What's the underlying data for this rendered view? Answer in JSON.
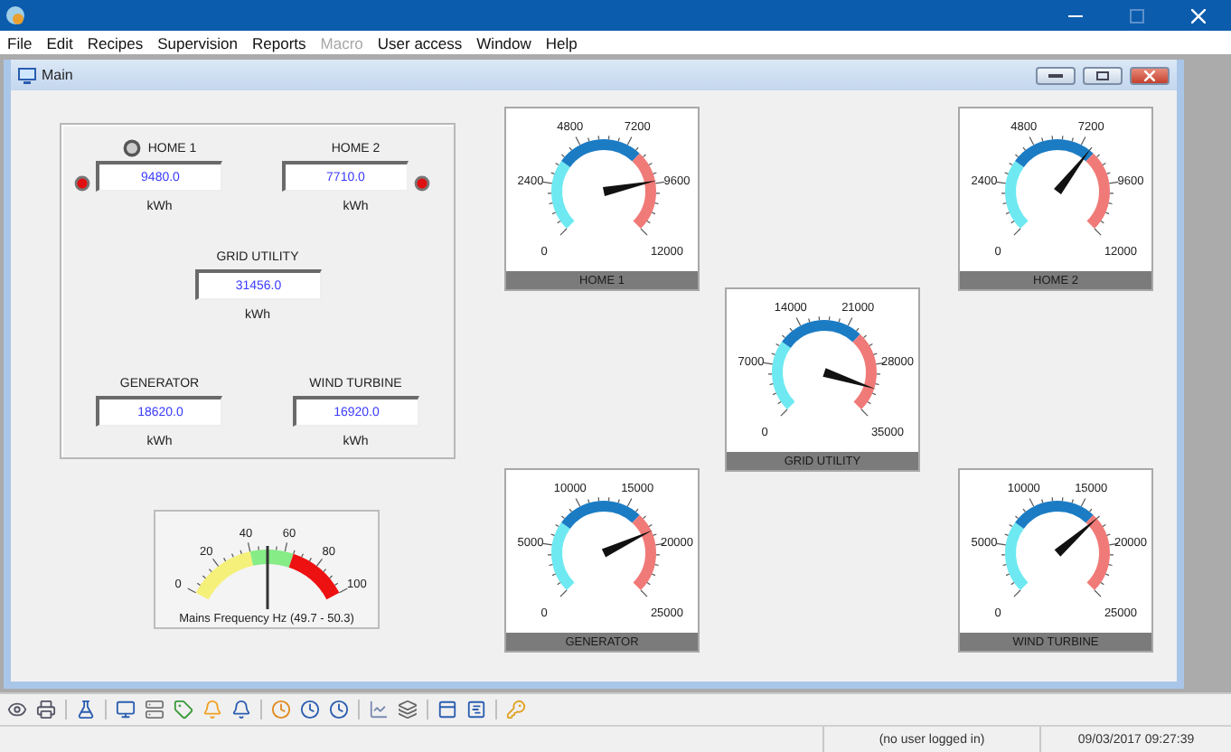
{
  "menu": [
    {
      "label": "File",
      "disabled": false
    },
    {
      "label": "Edit",
      "disabled": false
    },
    {
      "label": "Recipes",
      "disabled": false
    },
    {
      "label": "Supervision",
      "disabled": false
    },
    {
      "label": "Reports",
      "disabled": false
    },
    {
      "label": "Macro",
      "disabled": true
    },
    {
      "label": "User access",
      "disabled": false
    },
    {
      "label": "Window",
      "disabled": false
    },
    {
      "label": "Help",
      "disabled": false
    }
  ],
  "child_window": {
    "title": "Main"
  },
  "meters": [
    {
      "label": "HOME 1",
      "value": "9480.0",
      "unit": "kWh",
      "lamp": true
    },
    {
      "label": "HOME 2",
      "value": "7710.0",
      "unit": "kWh",
      "lamp": true
    },
    {
      "label": "GRID UTILITY",
      "value": "31456.0",
      "unit": "kWh",
      "lamp": false
    },
    {
      "label": "GENERATOR",
      "value": "18620.0",
      "unit": "kWh",
      "lamp": false
    },
    {
      "label": "WIND TURBINE",
      "value": "16920.0",
      "unit": "kWh",
      "lamp": false
    }
  ],
  "gauges": [
    {
      "title": "HOME 1",
      "scale": [
        "0",
        "2400",
        "4800",
        "7200",
        "9600",
        "12000"
      ]
    },
    {
      "title": "HOME 2",
      "scale": [
        "0",
        "2400",
        "4800",
        "7200",
        "9600",
        "12000"
      ]
    },
    {
      "title": "GRID UTILITY",
      "scale": [
        "0",
        "7000",
        "14000",
        "21000",
        "28000",
        "35000"
      ]
    },
    {
      "title": "GENERATOR",
      "scale": [
        "0",
        "5000",
        "10000",
        "15000",
        "20000",
        "25000"
      ]
    },
    {
      "title": "WIND TURBINE",
      "scale": [
        "0",
        "5000",
        "10000",
        "15000",
        "20000",
        "25000"
      ]
    }
  ],
  "frequency": {
    "caption": "Mains Frequency Hz (49.7 - 50.3)",
    "scale": [
      "0",
      "20",
      "40",
      "60",
      "80",
      "100"
    ]
  },
  "status_bar": [
    "(no user logged in)",
    "09/03/2017 09:27:39"
  ]
}
